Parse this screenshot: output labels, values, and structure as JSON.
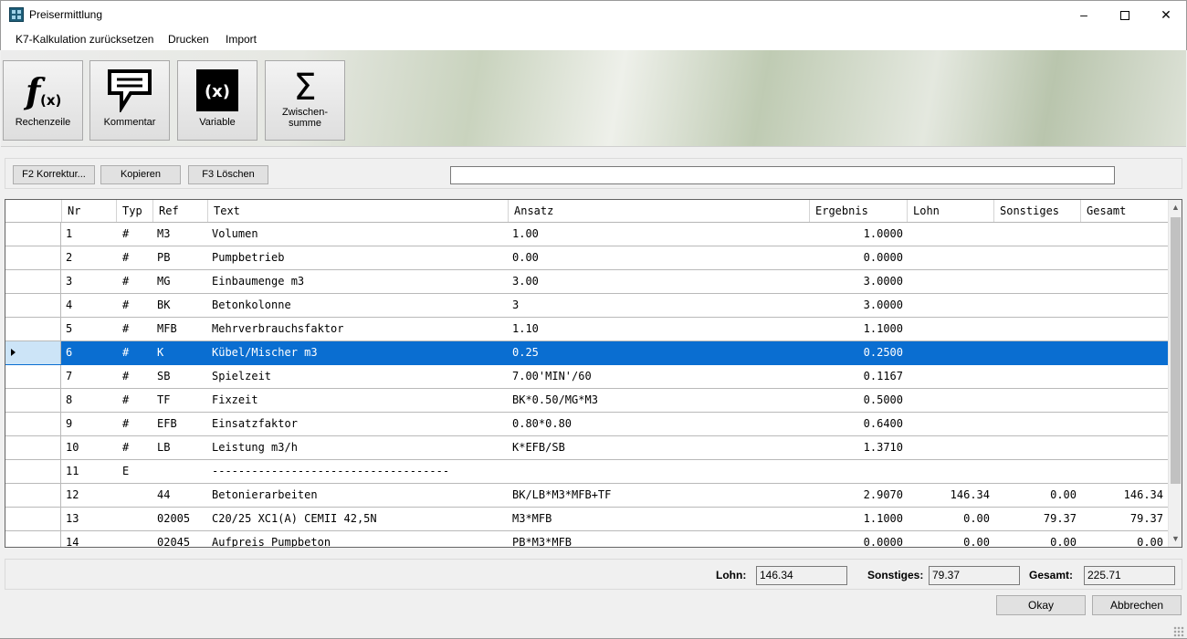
{
  "window": {
    "title": "Preisermittlung",
    "icon": "calculator-app-icon",
    "controls": {
      "minimize": "–",
      "close": "✕"
    }
  },
  "menu": [
    "K7-Kalkulation zurücksetzen",
    "Drucken",
    "Import"
  ],
  "ribbon": {
    "buttons": [
      {
        "label": "Rechenzeile",
        "icon": "function-fx-icon"
      },
      {
        "label": "Kommentar",
        "icon": "comment-icon"
      },
      {
        "label": "Variable",
        "icon": "variable-x-icon"
      },
      {
        "label": "Zwischen-\nsumme",
        "label_line1": "Zwischen-",
        "label_line2": "summe",
        "icon": "sigma-sum-icon"
      }
    ]
  },
  "toolbar": {
    "correction": "F2 Korrektur...",
    "copy": "Kopieren",
    "delete": "F3 Löschen",
    "input_value": ""
  },
  "grid": {
    "columns": [
      "Nr",
      "Typ",
      "Ref",
      "Text",
      "Ansatz",
      "Ergebnis",
      "Lohn",
      "Sonstiges",
      "Gesamt"
    ],
    "selected_row": 6,
    "rows": [
      {
        "nr": "1",
        "typ": "#",
        "ref": "M3",
        "text": "Volumen",
        "ansatz": "1.00",
        "ergebnis": "1.0000",
        "lohn": "",
        "sonstiges": "",
        "gesamt": ""
      },
      {
        "nr": "2",
        "typ": "#",
        "ref": "PB",
        "text": "Pumpbetrieb",
        "ansatz": "0.00",
        "ergebnis": "0.0000",
        "lohn": "",
        "sonstiges": "",
        "gesamt": ""
      },
      {
        "nr": "3",
        "typ": "#",
        "ref": "MG",
        "text": "Einbaumenge m3",
        "ansatz": "3.00",
        "ergebnis": "3.0000",
        "lohn": "",
        "sonstiges": "",
        "gesamt": ""
      },
      {
        "nr": "4",
        "typ": "#",
        "ref": "BK",
        "text": "Betonkolonne",
        "ansatz": "3",
        "ergebnis": "3.0000",
        "lohn": "",
        "sonstiges": "",
        "gesamt": ""
      },
      {
        "nr": "5",
        "typ": "#",
        "ref": "MFB",
        "text": "Mehrverbrauchsfaktor",
        "ansatz": "1.10",
        "ergebnis": "1.1000",
        "lohn": "",
        "sonstiges": "",
        "gesamt": ""
      },
      {
        "nr": "6",
        "typ": "#",
        "ref": "K",
        "text": "Kübel/Mischer m3",
        "ansatz": "0.25",
        "ergebnis": "0.2500",
        "lohn": "",
        "sonstiges": "",
        "gesamt": ""
      },
      {
        "nr": "7",
        "typ": "#",
        "ref": "SB",
        "text": "Spielzeit",
        "ansatz": "7.00'MIN'/60",
        "ergebnis": "0.1167",
        "lohn": "",
        "sonstiges": "",
        "gesamt": ""
      },
      {
        "nr": "8",
        "typ": "#",
        "ref": "TF",
        "text": "Fixzeit",
        "ansatz": "BK*0.50/MG*M3",
        "ergebnis": "0.5000",
        "lohn": "",
        "sonstiges": "",
        "gesamt": ""
      },
      {
        "nr": "9",
        "typ": "#",
        "ref": "EFB",
        "text": "Einsatzfaktor",
        "ansatz": "0.80*0.80",
        "ergebnis": "0.6400",
        "lohn": "",
        "sonstiges": "",
        "gesamt": ""
      },
      {
        "nr": "10",
        "typ": "#",
        "ref": "LB",
        "text": "Leistung m3/h",
        "ansatz": "K*EFB/SB",
        "ergebnis": "1.3710",
        "lohn": "",
        "sonstiges": "",
        "gesamt": ""
      },
      {
        "nr": "11",
        "typ": "E",
        "ref": "",
        "text": "------------------------------------",
        "ansatz": "",
        "ergebnis": "",
        "lohn": "",
        "sonstiges": "",
        "gesamt": ""
      },
      {
        "nr": "12",
        "typ": "",
        "ref": "44",
        "text": "Betonierarbeiten",
        "ansatz": "BK/LB*M3*MFB+TF",
        "ergebnis": "2.9070",
        "lohn": "146.34",
        "sonstiges": "0.00",
        "gesamt": "146.34"
      },
      {
        "nr": "13",
        "typ": "",
        "ref": "02005",
        "text": "C20/25 XC1(A) CEMII 42,5N",
        "ansatz": "M3*MFB",
        "ergebnis": "1.1000",
        "lohn": "0.00",
        "sonstiges": "79.37",
        "gesamt": "79.37"
      },
      {
        "nr": "14",
        "typ": "",
        "ref": "02045",
        "text": "Aufpreis Pumpbeton",
        "ansatz": "PB*M3*MFB",
        "ergebnis": "0.0000",
        "lohn": "0.00",
        "sonstiges": "0.00",
        "gesamt": "0.00"
      }
    ]
  },
  "summary": {
    "lohn_label": "Lohn:",
    "lohn_value": "146.34",
    "sonstiges_label": "Sonstiges:",
    "sonstiges_value": "79.37",
    "gesamt_label": "Gesamt:",
    "gesamt_value": "225.71"
  },
  "footer": {
    "ok": "Okay",
    "cancel": "Abbrechen"
  },
  "colors": {
    "selection": "#0a6ed1",
    "selected_row_header": "#cce4f7"
  }
}
